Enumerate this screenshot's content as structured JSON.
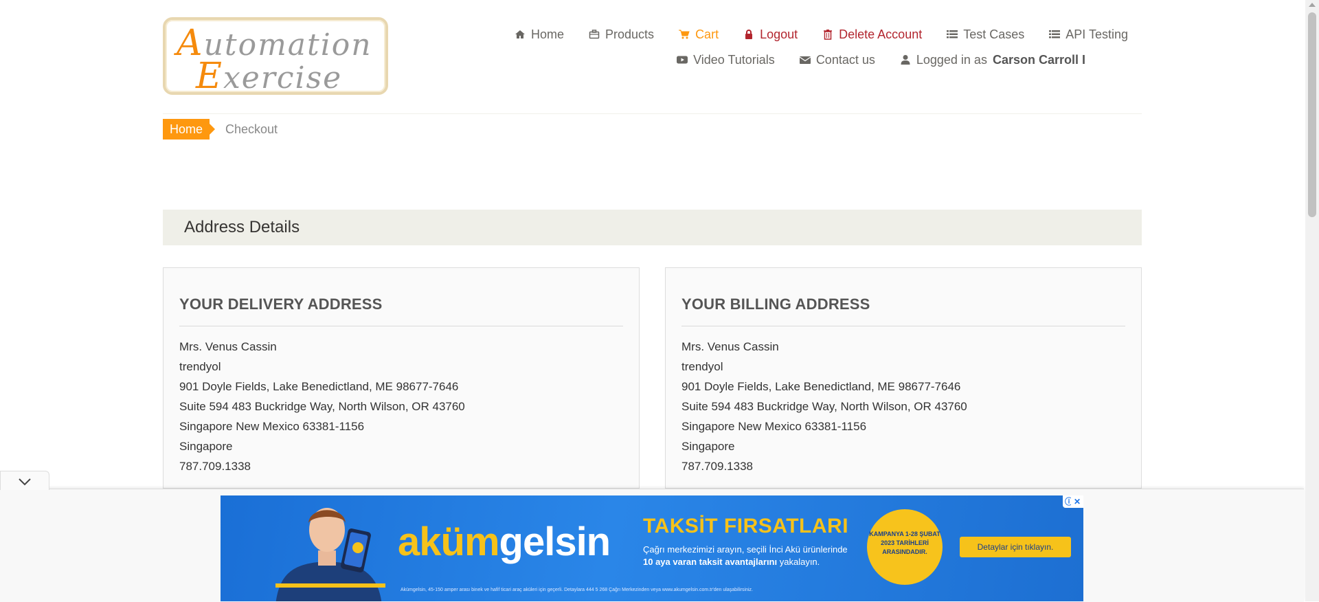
{
  "logo": {
    "line1_cap": "A",
    "line1_rest": "utomation",
    "line2_cap": "E",
    "line2_rest": "xercise"
  },
  "nav": {
    "row1": [
      {
        "label": "Home",
        "icon": "home-icon"
      },
      {
        "label": "Products",
        "icon": "briefcase-icon"
      },
      {
        "label": "Cart",
        "icon": "cart-icon"
      },
      {
        "label": "Logout",
        "icon": "lock-icon"
      },
      {
        "label": "Delete Account",
        "icon": "trash-icon"
      },
      {
        "label": "Test Cases",
        "icon": "list-icon"
      },
      {
        "label": "API Testing",
        "icon": "list-icon"
      }
    ],
    "row2": [
      {
        "label": "Video Tutorials",
        "icon": "youtube-play-icon"
      },
      {
        "label": "Contact us",
        "icon": "envelope-icon"
      }
    ],
    "logged_in_prefix": "Logged in as",
    "logged_in_user": "Carson Carroll I"
  },
  "breadcrumb": {
    "home": "Home",
    "current": "Checkout"
  },
  "section": {
    "heading": "Address Details"
  },
  "delivery": {
    "title": "YOUR DELIVERY ADDRESS",
    "lines": [
      "Mrs. Venus Cassin",
      "trendyol",
      "901 Doyle Fields, Lake Benedictland, ME 98677-7646",
      "Suite 594 483 Buckridge Way, North Wilson, OR 43760",
      "Singapore New Mexico 63381-1156",
      "Singapore",
      "787.709.1338"
    ]
  },
  "billing": {
    "title": "YOUR BILLING ADDRESS",
    "lines": [
      "Mrs. Venus Cassin",
      "trendyol",
      "901 Doyle Fields, Lake Benedictland, ME 98677-7646",
      "Suite 594 483 Buckridge Way, North Wilson, OR 43760",
      "Singapore New Mexico 63381-1156",
      "Singapore",
      "787.709.1338"
    ]
  },
  "ad": {
    "brand_a": "aküm",
    "brand_b": "gelsin",
    "title": "TAKSİT FIRSATLARI",
    "sub1": "Çağrı merkezimizi arayın, seçili İnci Akü ürünlerinde",
    "sub2": "10 aya varan taksit avantajlarını",
    "sub3": " yakalayın.",
    "badge": "KAMPANYA 1-28 ŞUBAT 2023 TARİHLERİ ARASINDADIR.",
    "cta": "Detaylar için tıklayın.",
    "fine": "Akümgelsin, 45-150 amper arası binek ve hafif ticari araç aküleri için geçerli. Detaylara 444 5 268 Çağrı Merkezinden veya www.akumgelsin.com.tr'den ulaşabilirsiniz.",
    "info": "ⓘ",
    "close": "✕"
  },
  "colors": {
    "accent": "#fe980f",
    "danger": "#b2252e",
    "ad_blue": "#1a6fd6",
    "ad_yellow": "#f6c21a"
  }
}
